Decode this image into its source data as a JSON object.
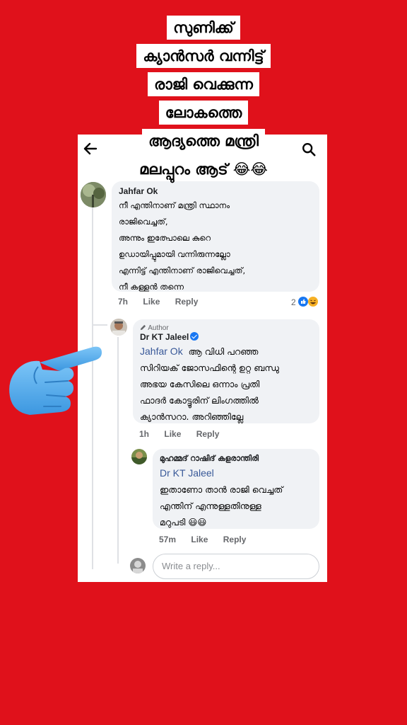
{
  "caption": {
    "lines": [
      "സുണിക്ക്",
      "ക്യാൻസർ വന്നിട്ട്",
      "രാജി വെക്കുന്ന",
      "ലോകത്തെ",
      "ആദ്യത്തെ മന്ത്രി",
      "മലപ്പുറം ആട് 😂😂"
    ]
  },
  "header": {
    "back_icon": "arrow-left-icon",
    "search_icon": "search-icon"
  },
  "comments": [
    {
      "author": "Jahfar Ok",
      "lines": [
        "നീ എന്തിനാണ് മന്ത്രി സ്ഥാനം",
        "രാജിവെച്ചത്,",
        "അന്നും ഇത്പോലെ കുറെ",
        "ഉഡായിപ്പുമായി വന്നിരുന്നല്ലോ",
        "എന്നിട്ട് എന്തിനാണ് രാജിവെച്ചത്,",
        "നീ കള്ളൻ തന്നെ"
      ],
      "time": "7h",
      "like": "Like",
      "reply": "Reply",
      "reaction_count": "2"
    },
    {
      "badge": "Author",
      "author": "Dr KT Jaleel",
      "mention": "Jahfar Ok",
      "first_line": "ആ വിധി പറഞ്ഞ",
      "lines": [
        "സിറിയക് ജോസഫിന്റെ ഉറ്റ ബന്ധു",
        "അഭയ കേസിലെ ഒന്നാം പ്രതി",
        "ഫാദർ കോട്ടൂരിന് ലിംഗത്തിൽ",
        "ക്യാൻസറാ. അറിഞ്ഞില്ലേ"
      ],
      "time": "1h",
      "like": "Like",
      "reply": "Reply"
    },
    {
      "author": "മുഹമ്മദ് റാഷിദ് കളരാന്തിരി",
      "mention": "Dr KT Jaleel",
      "lines": [
        "ഇതാണോ താൻ രാജി വെച്ചത്",
        "എന്തിന് എന്നുള്ളതിനുള്ള",
        "മറുപടി 😃😃"
      ],
      "time": "57m",
      "like": "Like",
      "reply": "Reply"
    }
  ],
  "reply_box": {
    "placeholder": "Write a reply..."
  },
  "colors": {
    "background": "#e0111b",
    "link": "#385898",
    "bubble": "#f0f2f5",
    "hand": "#5fb3f0"
  },
  "decor": {
    "pointing_hand": "pointing-hand-icon"
  }
}
